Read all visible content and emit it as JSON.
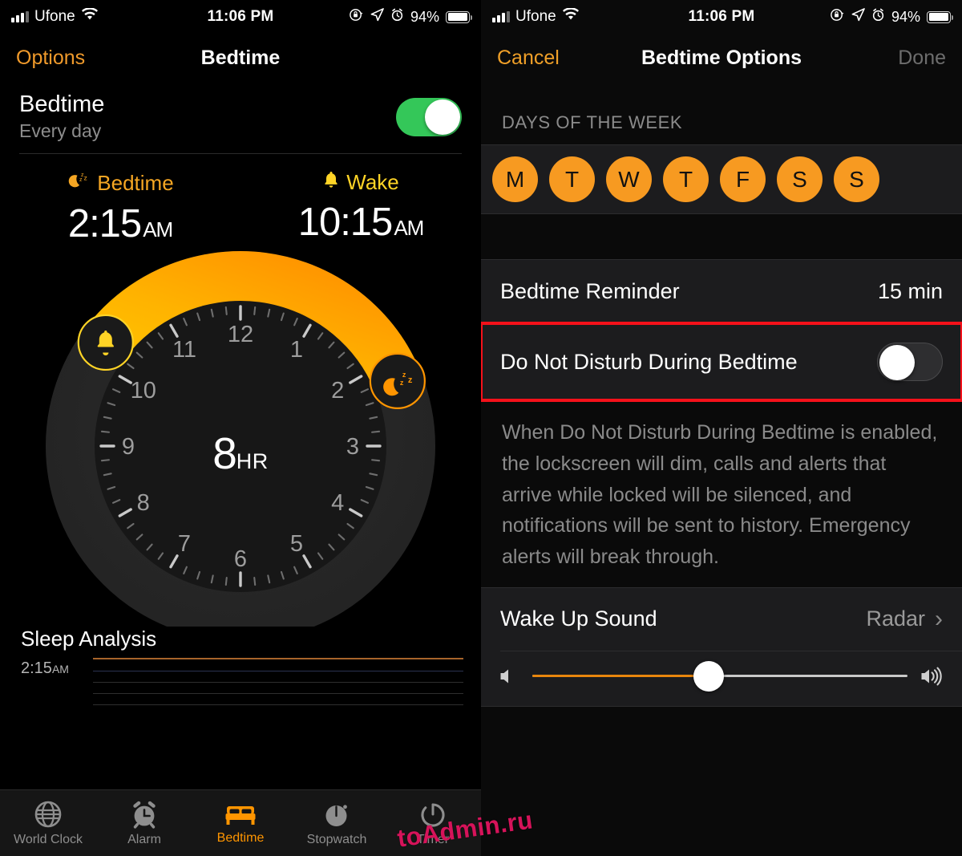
{
  "status_bar": {
    "carrier": "Ufone",
    "time": "11:06 PM",
    "battery_pct": "94%",
    "icons": [
      "signal-bars-icon",
      "wifi-icon",
      "rotation-lock-icon",
      "location-arrow-icon",
      "alarm-clock-icon",
      "battery-icon"
    ]
  },
  "left_panel": {
    "nav": {
      "left_button": "Options",
      "title": "Bedtime"
    },
    "bedtime_row": {
      "title": "Bedtime",
      "subtitle": "Every day",
      "toggle_state": "on"
    },
    "summary": {
      "bedtime_label": "Bedtime",
      "bedtime_time": "2:15",
      "bedtime_ampm": "AM",
      "wake_label": "Wake",
      "wake_time": "10:15",
      "wake_ampm": "AM"
    },
    "dial": {
      "duration_number": "8",
      "duration_unit": "HR",
      "hour_labels": [
        "12",
        "1",
        "2",
        "3",
        "4",
        "5",
        "6",
        "7",
        "8",
        "9",
        "10",
        "11"
      ],
      "bedtime_handle_hour": 2.25,
      "wake_handle_hour": 10.25,
      "arc_color_start": "#ffd426",
      "arc_color_end": "#ff9500"
    },
    "sleep_analysis": {
      "title": "Sleep Analysis",
      "axis_time": "2:15",
      "axis_ampm": "AM"
    },
    "tabs": [
      {
        "label": "World Clock",
        "icon": "globe-icon",
        "active": false
      },
      {
        "label": "Alarm",
        "icon": "alarm-clock-icon",
        "active": false
      },
      {
        "label": "Bedtime",
        "icon": "bed-icon",
        "active": true
      },
      {
        "label": "Stopwatch",
        "icon": "stopwatch-icon",
        "active": false
      },
      {
        "label": "Timer",
        "icon": "timer-icon",
        "active": false
      }
    ]
  },
  "right_panel": {
    "nav": {
      "left_button": "Cancel",
      "title": "Bedtime Options",
      "right_button": "Done"
    },
    "days_header": "DAYS OF THE WEEK",
    "days": [
      {
        "letter": "M",
        "selected": true
      },
      {
        "letter": "T",
        "selected": true
      },
      {
        "letter": "W",
        "selected": true
      },
      {
        "letter": "T",
        "selected": true
      },
      {
        "letter": "F",
        "selected": true
      },
      {
        "letter": "S",
        "selected": true
      },
      {
        "letter": "S",
        "selected": true
      }
    ],
    "reminder": {
      "label": "Bedtime Reminder",
      "value": "15 min"
    },
    "dnd": {
      "label": "Do Not Disturb During Bedtime",
      "toggle_state": "off",
      "highlighted": true,
      "highlight_color": "#f5111a"
    },
    "dnd_footnote": "When Do Not Disturb During Bedtime is enabled, the lockscreen will dim, calls and alerts that arrive while locked will be silenced, and notifications will be sent to history. Emergency alerts will break through.",
    "wake_sound": {
      "label": "Wake Up Sound",
      "value": "Radar",
      "chevron": "›"
    },
    "volume": {
      "level_pct": 47,
      "low_icon": "speaker-mute-icon",
      "high_icon": "speaker-loud-icon"
    }
  },
  "watermark": {
    "text": "toAdmin.ru",
    "color": "#d6135a"
  }
}
